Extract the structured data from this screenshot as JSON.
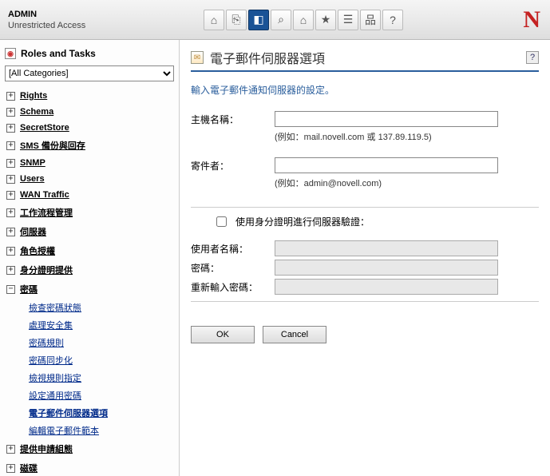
{
  "header": {
    "title": "ADMIN",
    "subtitle": "Unrestricted Access",
    "logo": "N"
  },
  "toolbar": {
    "items": [
      {
        "name": "home-icon",
        "glyph": "⌂",
        "active": false
      },
      {
        "name": "exit-icon",
        "glyph": "⎘",
        "active": false
      },
      {
        "name": "book-icon",
        "glyph": "◧",
        "active": true
      },
      {
        "name": "search-icon",
        "glyph": "⌕",
        "active": false
      },
      {
        "name": "tools-icon",
        "glyph": "⌂",
        "active": false
      },
      {
        "name": "favorite-icon",
        "glyph": "★",
        "active": false
      },
      {
        "name": "list-icon",
        "glyph": "☰",
        "active": false
      },
      {
        "name": "tree-icon",
        "glyph": "品",
        "active": false
      },
      {
        "name": "help-icon",
        "glyph": "?",
        "active": false
      }
    ]
  },
  "sidebar": {
    "title": "Roles and Tasks",
    "category_selected": "[All Categories]",
    "items": [
      {
        "label": "Rights",
        "expanded": false
      },
      {
        "label": "Schema",
        "expanded": false
      },
      {
        "label": "SecretStore",
        "expanded": false
      },
      {
        "label": "SMS 備份與回存",
        "expanded": false
      },
      {
        "label": "SNMP",
        "expanded": false
      },
      {
        "label": "Users",
        "expanded": false
      },
      {
        "label": "WAN Traffic",
        "expanded": false
      },
      {
        "label": "工作流程管理",
        "expanded": false
      },
      {
        "label": "伺服器",
        "expanded": false
      },
      {
        "label": "角色授權",
        "expanded": false
      },
      {
        "label": "身分證明提供",
        "expanded": false
      },
      {
        "label": "密碼",
        "expanded": true,
        "children": [
          {
            "label": "檢查密碼狀態",
            "current": false
          },
          {
            "label": "處理安全集",
            "current": false
          },
          {
            "label": "密碼規則",
            "current": false
          },
          {
            "label": "密碼同步化",
            "current": false
          },
          {
            "label": "檢視規則指定",
            "current": false
          },
          {
            "label": "設定通用密碼",
            "current": false
          },
          {
            "label": "電子郵件伺服器選項",
            "current": true
          },
          {
            "label": "編輯電子郵件範本",
            "current": false
          }
        ]
      },
      {
        "label": "提供申請組態",
        "expanded": false
      },
      {
        "label": "磁碟",
        "expanded": false
      }
    ]
  },
  "page": {
    "title": "電子郵件伺服器選項",
    "intro": "輸入電子郵件通知伺服器的設定。",
    "host_label": "主機名稱：",
    "host_hint": "(例如：mail.novell.com 或 137.89.119.5)",
    "from_label": "寄件者：",
    "from_hint": "(例如：admin@novell.com)",
    "auth_checkbox": "使用身分證明進行伺服器驗證：",
    "user_label": "使用者名稱：",
    "pass_label": "密碼：",
    "pass2_label": "重新輸入密碼：",
    "ok": "OK",
    "cancel": "Cancel"
  }
}
